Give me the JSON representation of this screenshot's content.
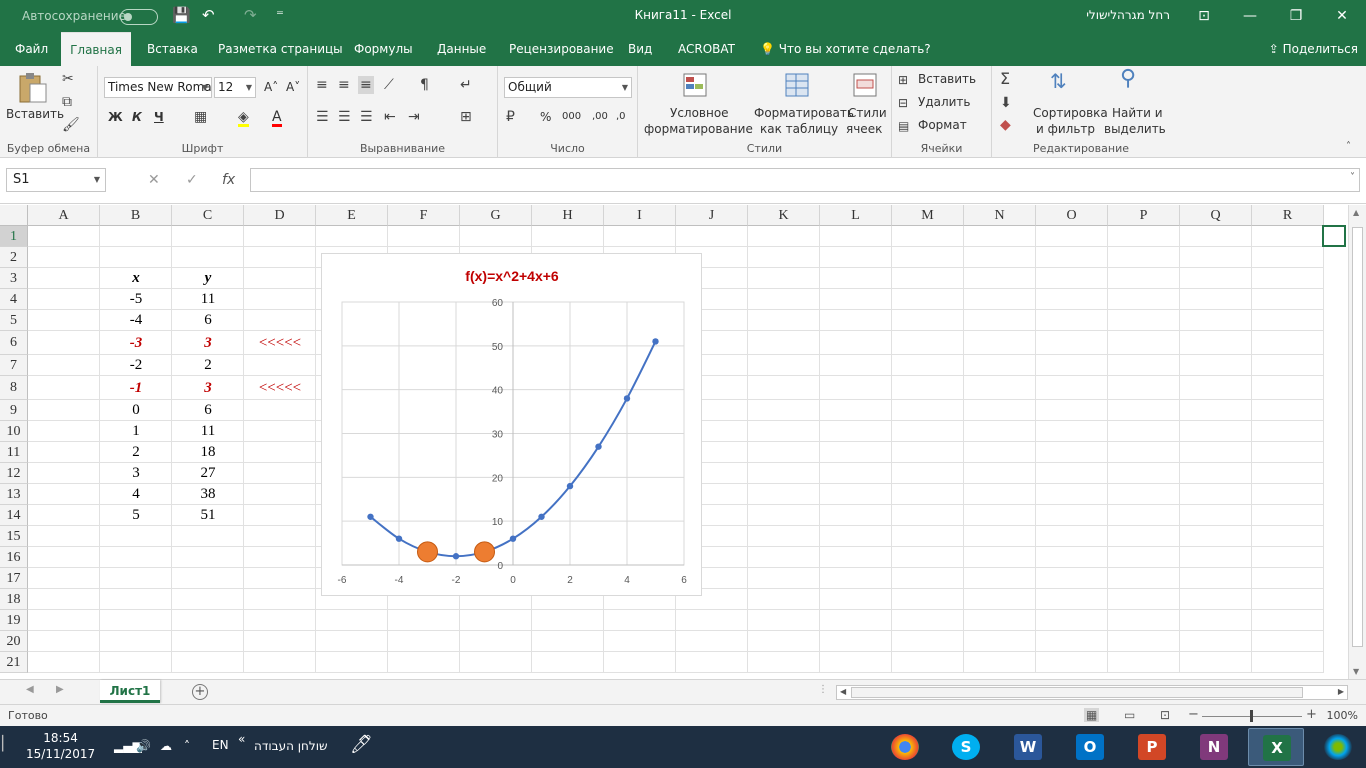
{
  "titlebar": {
    "autosave": "Автосохранение",
    "title": "Книга11  -  Excel",
    "user": "רחל מגרהלישולי",
    "qa_save": "💾",
    "qa_undo": "↶",
    "qa_redo": "↷",
    "qa_more": "⁼",
    "win_restore_ribbon": "⊡",
    "win_minimize": "—",
    "win_maximize": "❐",
    "win_close": "✕"
  },
  "tabs": [
    {
      "label": "Файл",
      "active": false
    },
    {
      "label": "Главная",
      "active": true
    },
    {
      "label": "Вставка",
      "active": false
    },
    {
      "label": "Разметка страницы",
      "active": false
    },
    {
      "label": "Формулы",
      "active": false
    },
    {
      "label": "Данные",
      "active": false
    },
    {
      "label": "Рецензирование",
      "active": false
    },
    {
      "label": "Вид",
      "active": false
    },
    {
      "label": "ACROBAT",
      "active": false
    }
  ],
  "tell_me": "Что вы хотите сделать?",
  "share": "Поделиться",
  "ribbon": {
    "clipboard": {
      "label": "Буфер обмена",
      "paste": "Вставить"
    },
    "font": {
      "label": "Шрифт",
      "name": "Times New Roma",
      "size": "12",
      "bold": "Ж",
      "italic": "К",
      "underline": "Ч",
      "grow": "A˄",
      "shrink": "A˅"
    },
    "alignment": {
      "label": "Выравнивание"
    },
    "number": {
      "label": "Число",
      "format": "Общий",
      "percent": "%",
      "thousands": "000",
      "inc_dec": ",00",
      "dec_dec": ",0"
    },
    "styles": {
      "label": "Стили",
      "conditional_1": "Условное",
      "conditional_2": "форматирование",
      "table_1": "Форматировать",
      "table_2": "как таблицу",
      "cell_1": "Стили",
      "cell_2": "ячеек"
    },
    "cells": {
      "label": "Ячейки",
      "insert": "Вставить",
      "delete": "Удалить",
      "format": "Формат"
    },
    "editing": {
      "label": "Редактирование",
      "sort_1": "Сортировка",
      "sort_2": "и фильтр",
      "find_1": "Найти и",
      "find_2": "выделить"
    }
  },
  "formula_bar": {
    "name_box": "S1",
    "fx": "fx",
    "cancel": "✕",
    "enter": "✓",
    "value": ""
  },
  "columns": [
    "A",
    "B",
    "C",
    "D",
    "E",
    "F",
    "G",
    "H",
    "I",
    "J",
    "K",
    "L",
    "M",
    "N",
    "O",
    "P",
    "Q",
    "R"
  ],
  "rows": [
    "1",
    "2",
    "3",
    "4",
    "5",
    "6",
    "7",
    "8",
    "9",
    "10",
    "11",
    "12",
    "13",
    "14",
    "15",
    "16",
    "17",
    "18",
    "19",
    "20",
    "21"
  ],
  "table": {
    "header_x": "x",
    "header_y": "y",
    "rows": [
      {
        "x": "-5",
        "y": "11",
        "mark": ""
      },
      {
        "x": "-4",
        "y": "6",
        "mark": ""
      },
      {
        "x": "-3",
        "y": "3",
        "mark": "<<<<<"
      },
      {
        "x": "-2",
        "y": "2",
        "mark": ""
      },
      {
        "x": "-1",
        "y": "3",
        "mark": "<<<<<"
      },
      {
        "x": "0",
        "y": "6",
        "mark": ""
      },
      {
        "x": "1",
        "y": "11",
        "mark": ""
      },
      {
        "x": "2",
        "y": "18",
        "mark": ""
      },
      {
        "x": "3",
        "y": "27",
        "mark": ""
      },
      {
        "x": "4",
        "y": "38",
        "mark": ""
      },
      {
        "x": "5",
        "y": "51",
        "mark": ""
      }
    ]
  },
  "chart_data": {
    "type": "scatter",
    "title": "f(x)=x^2+4x+6",
    "xlabel": "",
    "ylabel": "",
    "xlim": [
      -6,
      6
    ],
    "ylim": [
      0,
      60
    ],
    "xticks": [
      -6,
      -4,
      -2,
      0,
      2,
      4,
      6
    ],
    "yticks": [
      0,
      10,
      20,
      30,
      40,
      50,
      60
    ],
    "grid": true,
    "legend": "none",
    "title_color": "#c00000",
    "line_color": "#4472c4",
    "highlight_color": "#ed7d31",
    "series": [
      {
        "x": [
          -5,
          -4,
          -3,
          -2,
          -1,
          0,
          1,
          2,
          3,
          4,
          5
        ],
        "y": [
          11,
          6,
          3,
          2,
          3,
          6,
          11,
          18,
          27,
          38,
          51
        ]
      }
    ],
    "highlight": [
      {
        "x": -3,
        "y": 3
      },
      {
        "x": -1,
        "y": 3
      }
    ]
  },
  "sheet": {
    "tab": "Лист1",
    "add": "+"
  },
  "status": {
    "ready": "Готово",
    "zoom": "100%",
    "zoom_minus": "−",
    "zoom_plus": "+"
  },
  "taskbar": {
    "time": "18:54",
    "date": "15/11/2017",
    "lang": "EN",
    "desktop": "שולחן העבודה",
    "chevrons": "«"
  },
  "colors": {
    "excel_green": "#217346",
    "accent_red": "#c00000"
  }
}
